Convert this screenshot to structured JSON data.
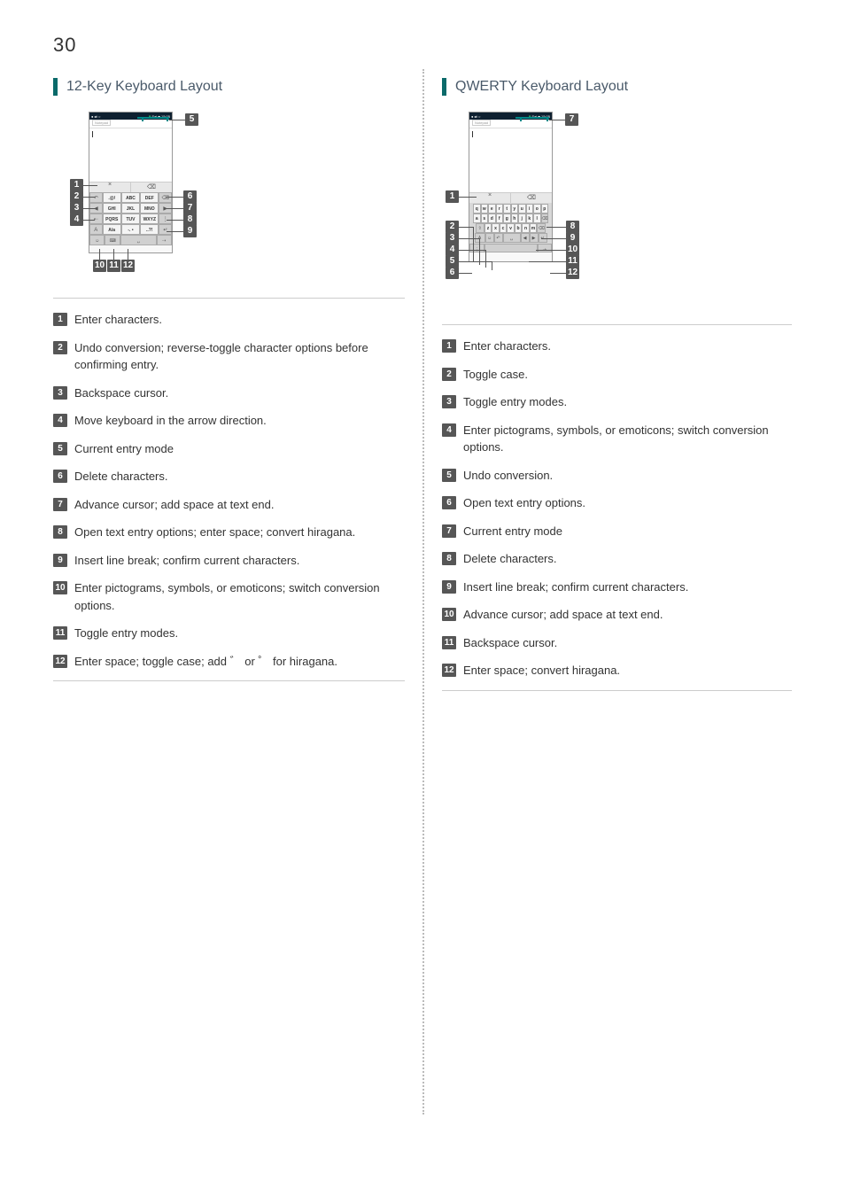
{
  "page_number": "30",
  "left": {
    "title": "12-Key Keyboard Layout",
    "phone": {
      "status_time": "Sat ■ 15:05",
      "app": "Notepad",
      "keys_r1": [
        ".@/",
        "ABC",
        "DEF"
      ],
      "keys_r2": [
        "GHI",
        "JKL",
        "MNO"
      ],
      "keys_r3": [
        "PQRS",
        "TUV",
        "WXYZ"
      ],
      "keys_r4": [
        "A/a",
        "-. •",
        "..?!"
      ],
      "cancel": "Cancel",
      "del_icon": "⌫"
    },
    "legend": [
      "Enter characters.",
      "Undo conversion; reverse-toggle character options before confirming entry.",
      "Backspace cursor.",
      "Move keyboard in the arrow direction.",
      "Current entry mode",
      "Delete characters.",
      "Advance cursor; add space at text end.",
      "Open text entry options; enter space; convert hiragana.",
      "Insert line break; confirm current characters.",
      "Enter pictograms, symbols, or emoticons; switch conversion options.",
      "Toggle entry modes.",
      "Enter space; toggle case; add ゛ or ゜  for hiragana."
    ]
  },
  "right": {
    "title": "QWERTY Keyboard Layout",
    "phone": {
      "status_time": "Sat ■ 15:05",
      "app": "Notepad",
      "row1": [
        "q",
        "w",
        "e",
        "r",
        "t",
        "y",
        "u",
        "i",
        "o",
        "p"
      ],
      "row2": [
        "a",
        "s",
        "d",
        "f",
        "g",
        "h",
        "j",
        "k",
        "l"
      ],
      "row3": [
        "z",
        "x",
        "c",
        "v",
        "b",
        "n",
        "m"
      ],
      "cancel": "Cancel",
      "del_icon": "⌫"
    },
    "legend": [
      "Enter characters.",
      "Toggle case.",
      "Toggle entry modes.",
      "Enter pictograms, symbols, or emoticons; switch conversion options.",
      "Undo conversion.",
      "Open text entry options.",
      "Current entry mode",
      "Delete characters.",
      "Insert line break; confirm current characters.",
      "Advance cursor; add space at text end.",
      "Backspace cursor.",
      "Enter space; convert hiragana."
    ]
  }
}
